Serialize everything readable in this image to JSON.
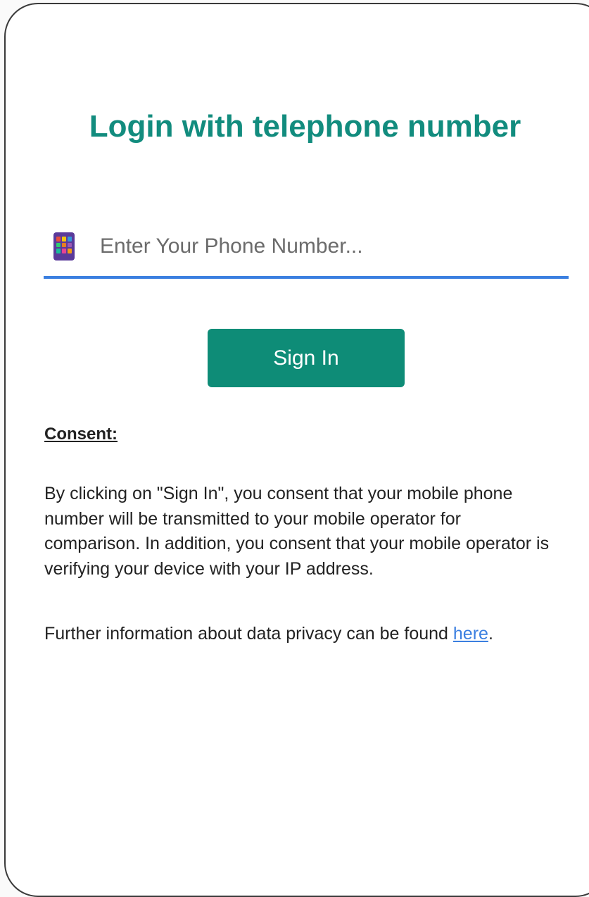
{
  "login": {
    "title": "Login with telephone number",
    "phone_placeholder": "Enter Your Phone Number...",
    "phone_value": "",
    "phone_icon": "mobile-phone-icon",
    "signin_label": "Sign In"
  },
  "consent": {
    "heading": "Consent:",
    "body": "By clicking on \"Sign In\", you consent that your mobile phone number will be transmitted to your mobile operator for comparison. In addition, you consent that your mobile operator is verifying your device with your IP address.",
    "privacy_prefix": "Further information about data privacy can be found ",
    "privacy_link": "here",
    "privacy_suffix": "."
  },
  "colors": {
    "title": "#128c7e",
    "button": "#0e8c77",
    "input_underline": "#3b7fe0",
    "link": "#3b7fe0"
  }
}
